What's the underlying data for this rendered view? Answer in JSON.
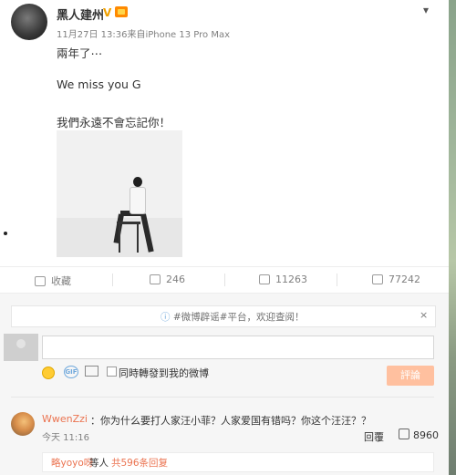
{
  "post": {
    "author": "黑人建州",
    "verified_badge": "V",
    "meta": "11月27日 13:36来自iPhone 13 Pro Max",
    "text_line1": "兩年了⋯",
    "text_line2": "We miss you  G",
    "text_line3": "我們永遠不會忘記你！",
    "more_icon": "chevron-down-icon"
  },
  "actions": {
    "favorite_label": "收藏",
    "repost_count": "246",
    "comment_count": "11263",
    "like_count": "77242"
  },
  "comments": {
    "notice": "#微博辟谣#平台，欢迎查阅！",
    "close": "×",
    "input_value": "",
    "checkbox_label": "同時轉發到我的微博",
    "submit_label": "評論",
    "gif_label": "GIF",
    "items": [
      {
        "user": "WwenZzi",
        "text": "：你为什么要打人家汪小菲？人家爱国有错吗？你这个汪汪？？",
        "time": "今天 11:16",
        "reply_label": "回覆",
        "likes": "8960",
        "sub_reply_user": "略yoyo呀",
        "sub_reply_mid": "等人",
        "sub_reply_link": "共596条回复"
      }
    ]
  },
  "colors": {
    "accent": "#eb7350",
    "submit_disabled": "#ffc09f",
    "muted": "#808080"
  }
}
